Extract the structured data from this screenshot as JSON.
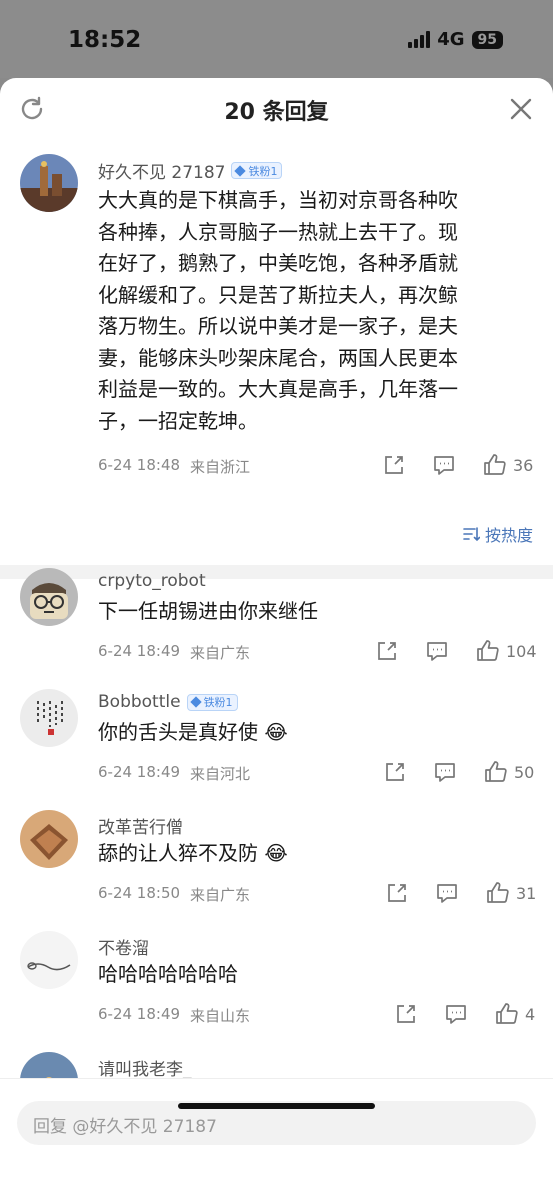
{
  "status_bar": {
    "time": "18:52",
    "network": "4G",
    "battery": "95"
  },
  "sheet": {
    "title": "20 条回复",
    "icons": [
      "refresh-icon",
      "close-icon"
    ]
  },
  "main_comment": {
    "username": "好久不见 27187",
    "badge": "铁粉1",
    "text_lines": [
      "大大真的是下棋高手，当初对京哥各种吹",
      "各种捧，人京哥脑子一热就上去干了。现",
      "在好了，鹅熟了，中美吃饱，各种矛盾就",
      "化解缓和了。只是苦了斯拉夫人，再次鲸",
      "落万物生。所以说中美才是一家子，是夫",
      "妻，能够床头吵架床尾合，两国人民更本",
      "利益是一致的。大大真是高手，几年落一",
      "子，一招定乾坤。"
    ],
    "time": "6-24 18:48",
    "location": "来自浙江",
    "likes": "36"
  },
  "sort": {
    "label": "按热度",
    "icon": "sort-icon"
  },
  "replies": [
    {
      "username": "crpyto_robot",
      "badge": "",
      "text": "下一任胡锡进由你来继任",
      "emoji": "",
      "time": "6-24 18:49",
      "location": "来自广东",
      "likes": "104"
    },
    {
      "username": "Bobbottle",
      "badge": "铁粉1",
      "text": "你的舌头是真好使",
      "emoji": "😂",
      "time": "6-24 18:49",
      "location": "来自河北",
      "likes": "50"
    },
    {
      "username": "改革苦行僧",
      "badge": "",
      "text": "舔的让人猝不及防",
      "emoji": "😂",
      "time": "6-24 18:50",
      "location": "来自广东",
      "likes": "31"
    },
    {
      "username": "不卷溜",
      "badge": "",
      "text": "哈哈哈哈哈哈哈",
      "emoji": "",
      "time": "6-24 18:49",
      "location": "来自山东",
      "likes": "4"
    },
    {
      "username": "请叫我老李_",
      "badge": "",
      "text": "",
      "emoji": "",
      "time": "",
      "location": "",
      "likes": ""
    }
  ],
  "reply_bar": {
    "placeholder": "回复 @好久不见 27187"
  }
}
